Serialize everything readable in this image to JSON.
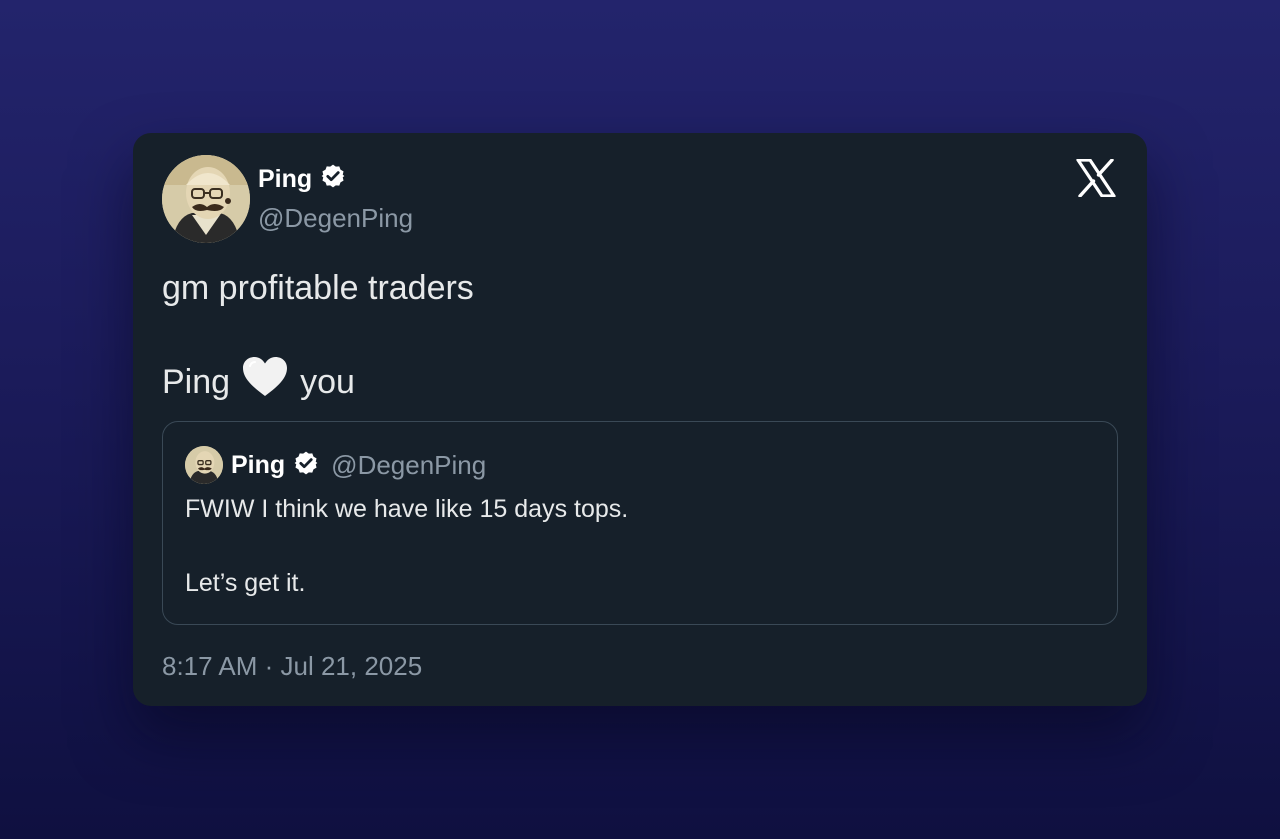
{
  "tweet": {
    "author_name": "Ping",
    "author_handle": "@DegenPing",
    "verified_icon": "verified-badge-icon",
    "platform_icon": "x-logo-icon",
    "text_line1": "gm profitable traders",
    "text_line2_before": "Ping",
    "text_line2_emoji": "white-heart-icon",
    "text_line2_after": "you",
    "timestamp": "8:17 AM · Jul 21, 2025"
  },
  "quoted_tweet": {
    "author_name": "Ping",
    "author_handle": "@DegenPing",
    "text_line1": "FWIW I think we have like 15 days tops.",
    "text_line2": "Let’s get it."
  },
  "colors": {
    "card_bg": "#16202a",
    "primary_text": "#e7e9ea",
    "secondary_text": "#8b98a5",
    "quote_border": "#3a4956",
    "page_bg_top": "#23246c",
    "page_bg_bottom": "#0f1040"
  }
}
